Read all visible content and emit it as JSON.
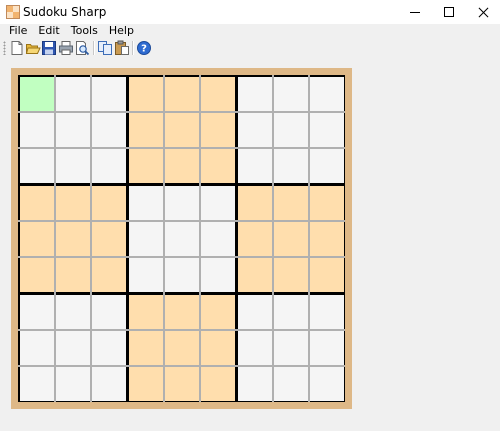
{
  "window": {
    "title": "Sudoku Sharp",
    "app_icon": "sudoku-app-icon"
  },
  "menu": [
    "File",
    "Edit",
    "Tools",
    "Help"
  ],
  "toolbar": {
    "buttons": [
      "new-icon",
      "open-icon",
      "save-icon",
      "print-icon",
      "print-preview-icon",
      "copy-icon",
      "paste-icon",
      "help-icon"
    ]
  },
  "board": {
    "size": 9,
    "selected": {
      "row": 1,
      "col": 1
    },
    "colors": {
      "frame": "#deb887",
      "shaded_box": "#ffdead",
      "plain_box": "#f5f5f5",
      "selected": "#c1ffc1",
      "thin_line": "#b0b0b0",
      "thick_line": "#000000"
    },
    "values": [
      [
        "",
        "",
        "",
        "",
        "",
        "",
        "",
        "",
        ""
      ],
      [
        "",
        "",
        "",
        "",
        "",
        "",
        "",
        "",
        ""
      ],
      [
        "",
        "",
        "",
        "",
        "",
        "",
        "",
        "",
        ""
      ],
      [
        "",
        "",
        "",
        "",
        "",
        "",
        "",
        "",
        ""
      ],
      [
        "",
        "",
        "",
        "",
        "",
        "",
        "",
        "",
        ""
      ],
      [
        "",
        "",
        "",
        "",
        "",
        "",
        "",
        "",
        ""
      ],
      [
        "",
        "",
        "",
        "",
        "",
        "",
        "",
        "",
        ""
      ],
      [
        "",
        "",
        "",
        "",
        "",
        "",
        "",
        "",
        ""
      ],
      [
        "",
        "",
        "",
        "",
        "",
        "",
        "",
        "",
        ""
      ]
    ]
  }
}
